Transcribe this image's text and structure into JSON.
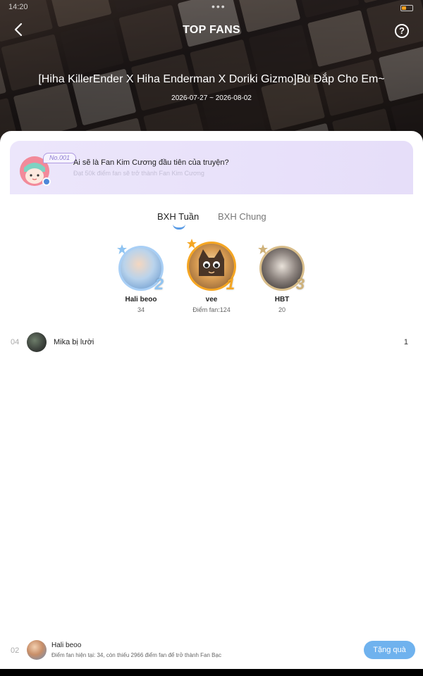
{
  "status_bar": {
    "time": "14:20",
    "dots": "•••"
  },
  "header": {
    "title": "TOP FANS",
    "help_label": "?",
    "story_title": "[Hiha KillerEnder X Hiha Enderman X Doriki Gizmo]Bù Đắp Cho Em~",
    "date_range": "2026-07-27 ~ 2026-08-02"
  },
  "banner": {
    "badge": "No.001",
    "question": "Ai sẽ là Fan Kim Cương đầu tiên của truyện?",
    "subtitle": "Đạt 50k điểm fan sẽ trở thành Fan Kim Cương"
  },
  "tabs": [
    {
      "label": "BXH Tuần",
      "active": true
    },
    {
      "label": "BXH Chung",
      "active": false
    }
  ],
  "podium": [
    {
      "rank": "2",
      "name": "Hali beoo",
      "score": "34",
      "ring_color": "#a9cff5",
      "rank_color": "#8fc4f2"
    },
    {
      "rank": "1",
      "name": "vee",
      "score": "Điểm fan:124",
      "ring_color": "#f5a623",
      "rank_color": "#f5a623"
    },
    {
      "rank": "3",
      "name": "HBT",
      "score": "20",
      "ring_color": "#d8bd8a",
      "rank_color": "#cfb27a"
    }
  ],
  "ranking_list": [
    {
      "rank": "04",
      "name": "Mika bị lười",
      "score": "1"
    }
  ],
  "bottom_bar": {
    "rank": "02",
    "name": "Hali beoo",
    "status": "Điểm fan hiện tại: 34, còn thiếu 2966 điểm fan để trở thành Fan Bạc",
    "gift_label": "Tặng quà"
  },
  "colors": {
    "accent": "#6fb2ee",
    "tab_underline": "#5b9ce6",
    "banner_bg": "#ece6fb"
  }
}
